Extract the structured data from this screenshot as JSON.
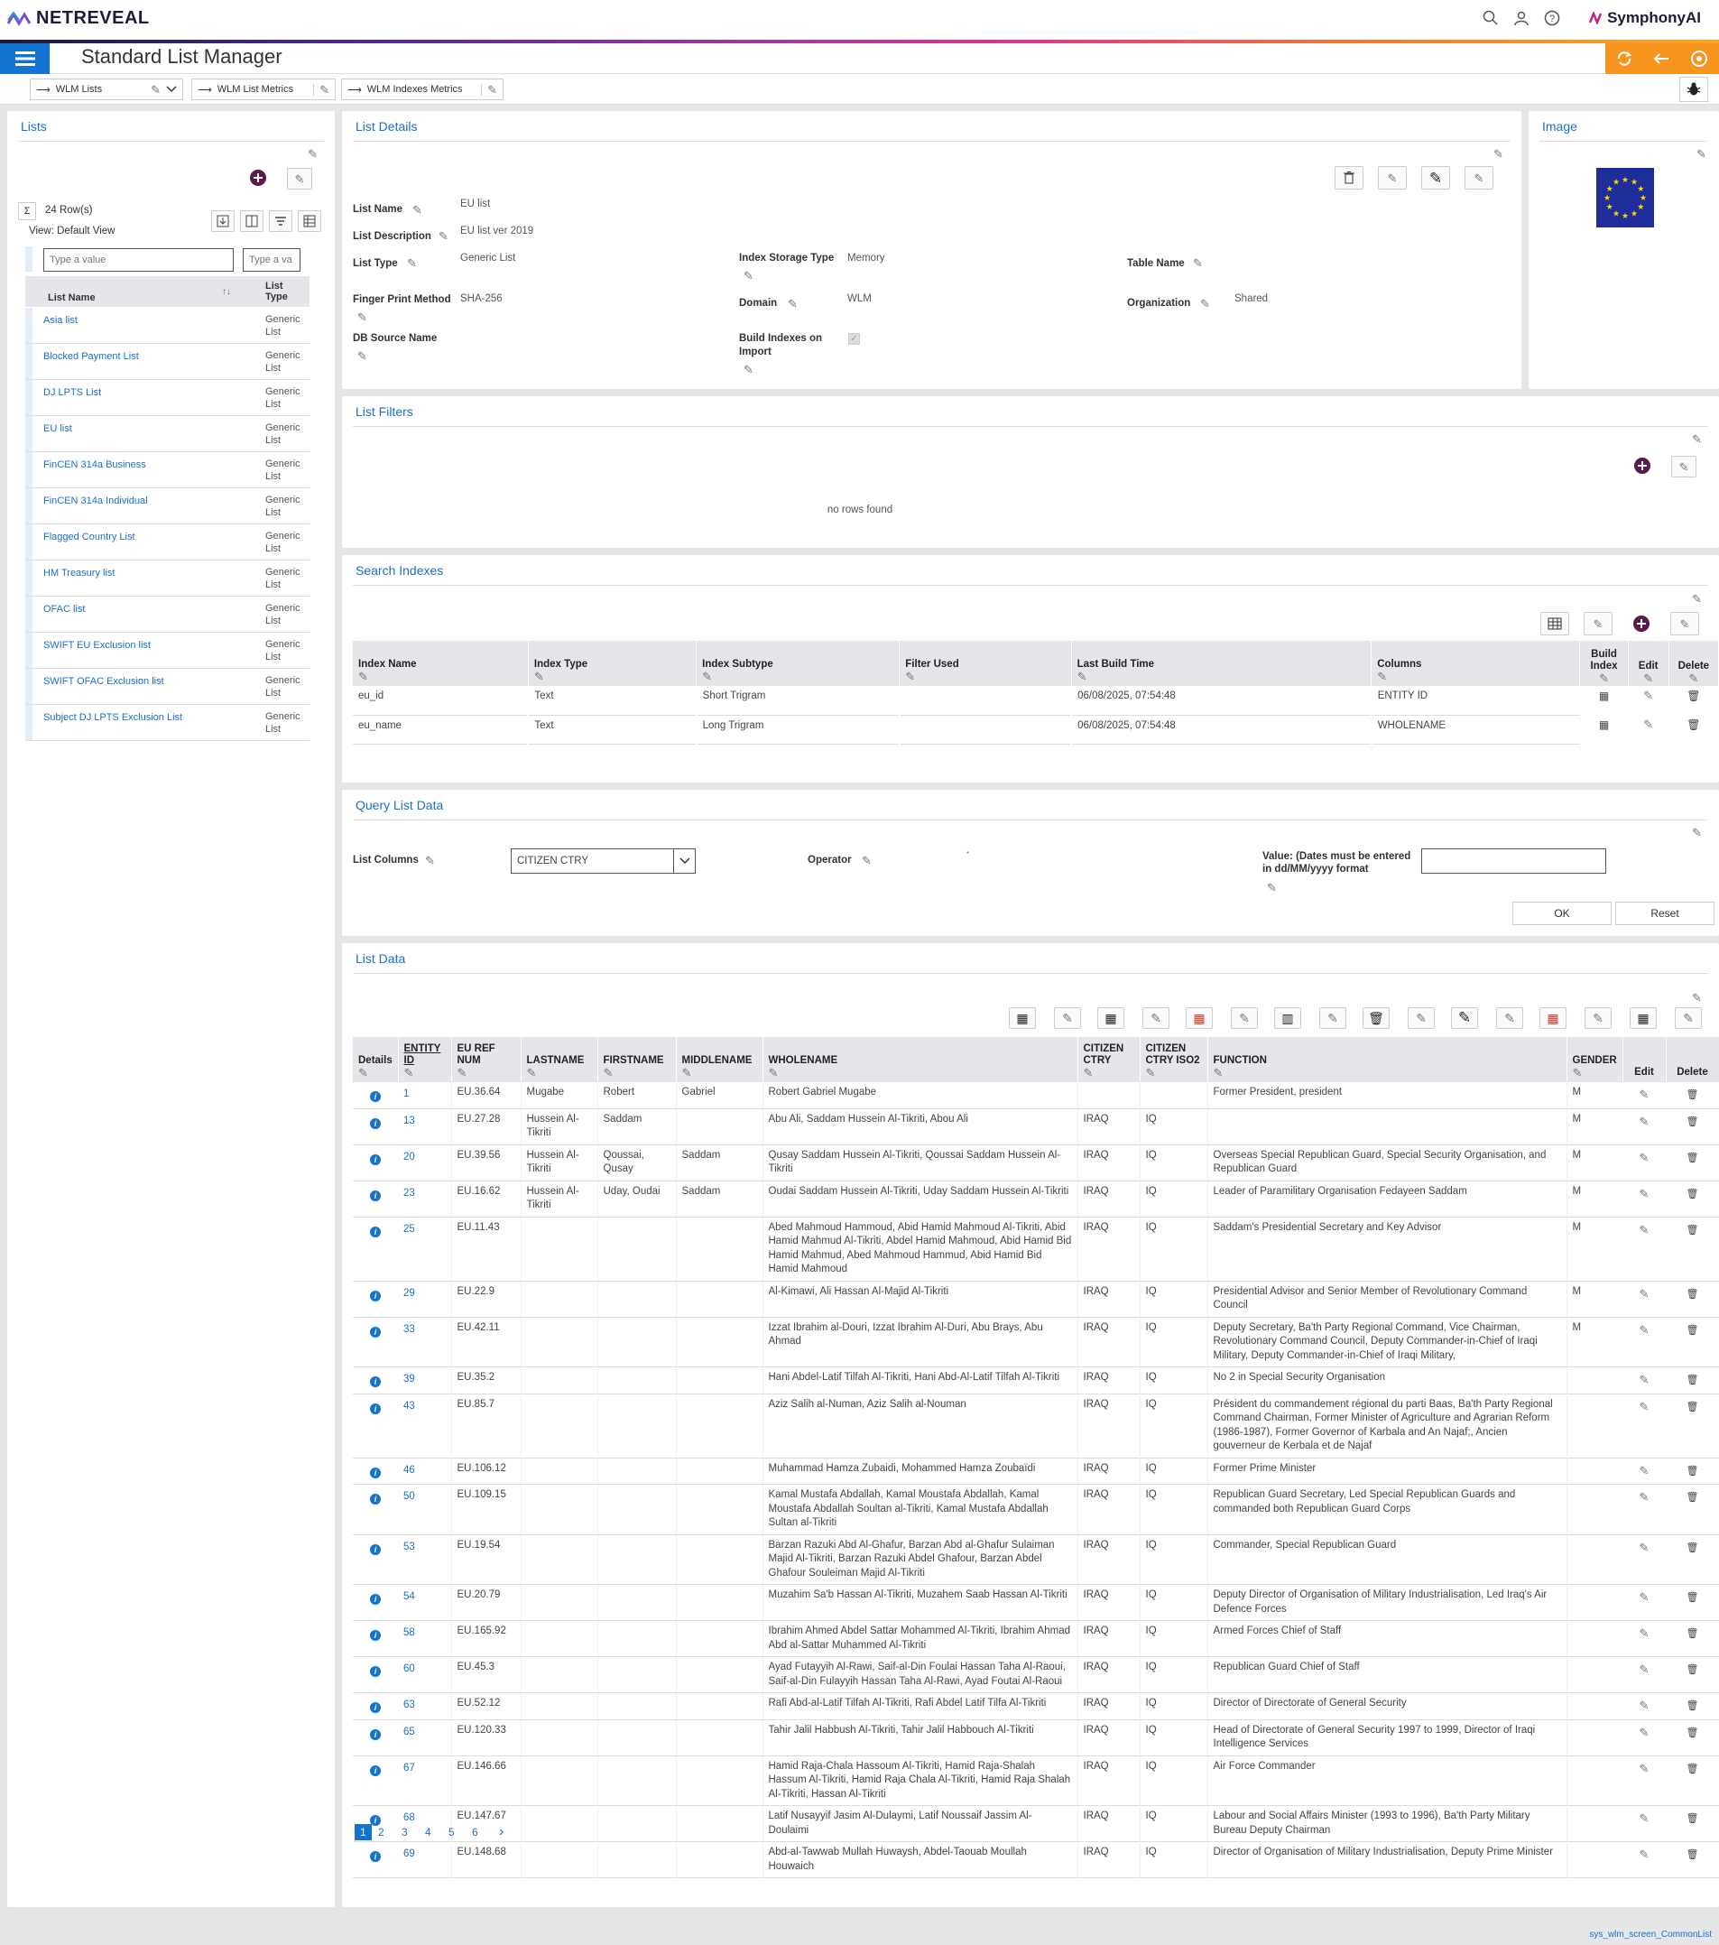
{
  "header": {
    "logo": "NETREVEAL",
    "brand": "SymphonyAI",
    "app_title": "Standard List Manager"
  },
  "tabs": [
    {
      "label": "WLM Lists"
    },
    {
      "label": "WLM List Metrics"
    },
    {
      "label": "WLM Indexes Metrics"
    }
  ],
  "lists_panel": {
    "title": "Lists",
    "row_count": "24 Row(s)",
    "view": "View: Default View",
    "filter_placeholder": "Type a value",
    "filter_placeholder2": "Type a va",
    "col_name": "List Name",
    "col_type": "List Type",
    "items": [
      {
        "name": "Asia list",
        "type": "Generic List"
      },
      {
        "name": "Blocked Payment List",
        "type": "Generic List"
      },
      {
        "name": "DJ LPTS List",
        "type": "Generic List"
      },
      {
        "name": "EU list",
        "type": "Generic List"
      },
      {
        "name": "FinCEN 314a Business",
        "type": "Generic List"
      },
      {
        "name": "FinCEN 314a Individual",
        "type": "Generic List"
      },
      {
        "name": "Flagged Country List",
        "type": "Generic List"
      },
      {
        "name": "HM Treasury list",
        "type": "Generic List"
      },
      {
        "name": "OFAC list",
        "type": "Generic List"
      },
      {
        "name": "SWIFT EU Exclusion list",
        "type": "Generic List"
      },
      {
        "name": "SWIFT OFAC Exclusion list",
        "type": "Generic List"
      },
      {
        "name": "Subject DJ LPTS Exclusion List",
        "type": "Generic List"
      }
    ]
  },
  "details": {
    "title": "List Details",
    "list_name_lbl": "List Name",
    "list_name": "EU list",
    "list_desc_lbl": "List Description",
    "list_desc": "EU list ver 2019",
    "list_type_lbl": "List Type",
    "list_type": "Generic List",
    "fp_lbl": "Finger Print Method",
    "fp": "SHA-256",
    "db_lbl": "DB Source Name",
    "storage_lbl": "Index Storage Type",
    "storage": "Memory",
    "domain_lbl": "Domain",
    "domain": "WLM",
    "build_lbl": "Build Indexes on Import",
    "table_lbl": "Table Name",
    "org_lbl": "Organization",
    "org": "Shared"
  },
  "image_panel": {
    "title": "Image"
  },
  "filters": {
    "title": "List Filters",
    "empty": "no rows found"
  },
  "indexes": {
    "title": "Search Indexes",
    "headers": [
      "Index Name",
      "Index Type",
      "Index Subtype",
      "Filter Used",
      "Last Build Time",
      "Columns",
      "Build Index",
      "Edit",
      "Delete"
    ],
    "rows": [
      {
        "name": "eu_id",
        "type": "Text",
        "subtype": "Short Trigram",
        "filter": "",
        "time": "06/08/2025, 07:54:48",
        "columns": "ENTITY ID"
      },
      {
        "name": "eu_name",
        "type": "Text",
        "subtype": "Long Trigram",
        "filter": "",
        "time": "06/08/2025, 07:54:48",
        "columns": "WHOLENAME"
      }
    ]
  },
  "query": {
    "title": "Query List Data",
    "cols_lbl": "List Columns",
    "cols_val": "CITIZEN CTRY",
    "op_lbl": "Operator",
    "value_lbl": "Value: (Dates must be entered in dd/MM/yyyy format",
    "ok": "OK",
    "reset": "Reset"
  },
  "listdata": {
    "title": "List Data",
    "headers": [
      "Details",
      "ENTITY ID",
      "EU REF NUM",
      "LASTNAME",
      "FIRSTNAME",
      "MIDDLENAME",
      "WHOLENAME",
      "CITIZEN CTRY",
      "CITIZEN CTRY ISO2",
      "FUNCTION",
      "GENDER",
      "Edit",
      "Delete"
    ],
    "rows": [
      {
        "id": "1",
        "ref": "EU.36.64",
        "last": "Mugabe",
        "first": "Robert",
        "middle": "Gabriel",
        "whole": "Robert Gabriel Mugabe",
        "ctry": "",
        "iso": "",
        "func": "Former President, president",
        "gender": "M"
      },
      {
        "id": "13",
        "ref": "EU.27.28",
        "last": "Hussein Al-Tikriti",
        "first": "Saddam",
        "middle": "",
        "whole": "Abu Ali, Saddam Hussein Al-Tikriti, Abou Ali",
        "ctry": "IRAQ",
        "iso": "IQ",
        "func": "",
        "gender": "M"
      },
      {
        "id": "20",
        "ref": "EU.39.56",
        "last": "Hussein Al-Tikriti",
        "first": "Qoussai, Qusay",
        "middle": "Saddam",
        "whole": "Qusay Saddam Hussein Al-Tikriti, Qoussai Saddam Hussein Al-Tikriti",
        "ctry": "IRAQ",
        "iso": "IQ",
        "func": "Overseas Special Republican Guard, Special Security Organisation, and Republican Guard",
        "gender": "M"
      },
      {
        "id": "23",
        "ref": "EU.16.62",
        "last": "Hussein Al-Tikriti",
        "first": "Uday, Oudai",
        "middle": "Saddam",
        "whole": "Oudai Saddam Hussein Al-Tikriti, Uday Saddam Hussein Al-Tikriti",
        "ctry": "IRAQ",
        "iso": "IQ",
        "func": "Leader of Paramilitary Organisation Fedayeen Saddam",
        "gender": "M"
      },
      {
        "id": "25",
        "ref": "EU.11.43",
        "last": "",
        "first": "",
        "middle": "",
        "whole": "Abed Mahmoud Hammoud, Abid Hamid Mahmoud Al-Tikriti, Abid Hamid Mahmud Al-Tikriti, Abdel Hamid Mahmoud, Abid Hamid Bid Hamid Mahmud, Abed Mahmoud Hammud, Abid Hamid Bid Hamid Mahmoud",
        "ctry": "IRAQ",
        "iso": "IQ",
        "func": "Saddam's Presidential Secretary and Key Advisor",
        "gender": "M"
      },
      {
        "id": "29",
        "ref": "EU.22.9",
        "last": "",
        "first": "",
        "middle": "",
        "whole": "Al-Kimawi, Ali Hassan Al-Majid Al-Tikriti",
        "ctry": "IRAQ",
        "iso": "IQ",
        "func": "Presidential Advisor and Senior Member of Revolutionary Command Council",
        "gender": "M"
      },
      {
        "id": "33",
        "ref": "EU.42.11",
        "last": "",
        "first": "",
        "middle": "",
        "whole": "Izzat Ibrahim al-Douri, Izzat Ibrahim Al-Duri, Abu Brays, Abu Ahmad",
        "ctry": "IRAQ",
        "iso": "IQ",
        "func": "Deputy Secretary, Ba'th Party Regional Command, Vice Chairman, Revolutionary Command Council, Deputy Commander-in-Chief of Iraqi Military, Deputy Commander-in-Chief of Iraqi Military,",
        "gender": "M"
      },
      {
        "id": "39",
        "ref": "EU.35.2",
        "last": "",
        "first": "",
        "middle": "",
        "whole": "Hani Abdel-Latif Tilfah Al-Tikriti, Hani Abd-Al-Latif Tilfah Al-Tikriti",
        "ctry": "IRAQ",
        "iso": "IQ",
        "func": "No 2 in Special Security Organisation",
        "gender": ""
      },
      {
        "id": "43",
        "ref": "EU.85.7",
        "last": "",
        "first": "",
        "middle": "",
        "whole": "Aziz Salih al-Numan, Aziz Salih al-Nouman",
        "ctry": "IRAQ",
        "iso": "IQ",
        "func": "Président du commandement régional du parti Baas, Ba'th Party Regional Command Chairman, Former Minister of Agriculture and Agrarian Reform (1986-1987), Former Governor of Karbala and An Najaf;, Ancien gouverneur de Kerbala et de Najaf",
        "gender": ""
      },
      {
        "id": "46",
        "ref": "EU.106.12",
        "last": "",
        "first": "",
        "middle": "",
        "whole": "Muhammad Hamza Zubaidi, Mohammed Hamza Zoubaïdi",
        "ctry": "IRAQ",
        "iso": "IQ",
        "func": "Former Prime Minister",
        "gender": ""
      },
      {
        "id": "50",
        "ref": "EU.109.15",
        "last": "",
        "first": "",
        "middle": "",
        "whole": "Kamal Mustafa Abdallah, Kamal Moustafa Abdallah, Kamal Moustafa Abdallah Soultan al-Tikriti, Kamal Mustafa Abdallah Sultan al-Tikriti",
        "ctry": "IRAQ",
        "iso": "IQ",
        "func": "Republican Guard Secretary, Led Special Republican Guards and commanded both Republican Guard Corps",
        "gender": ""
      },
      {
        "id": "53",
        "ref": "EU.19.54",
        "last": "",
        "first": "",
        "middle": "",
        "whole": "Barzan Razuki Abd Al-Ghafur, Barzan Abd al-Ghafur Sulaiman Majid Al-Tikriti, Barzan Razuki Abdel Ghafour, Barzan Abdel Ghafour Souleiman Majid Al-Tikriti",
        "ctry": "IRAQ",
        "iso": "IQ",
        "func": "Commander, Special Republican Guard",
        "gender": ""
      },
      {
        "id": "54",
        "ref": "EU.20.79",
        "last": "",
        "first": "",
        "middle": "",
        "whole": "Muzahim Sa'b Hassan Al-Tikriti, Muzahem Saab Hassan Al-Tikriti",
        "ctry": "IRAQ",
        "iso": "IQ",
        "func": "Deputy Director of Organisation of Military Industrialisation, Led Iraq's Air Defence Forces",
        "gender": ""
      },
      {
        "id": "58",
        "ref": "EU.165.92",
        "last": "",
        "first": "",
        "middle": "",
        "whole": "Ibrahim Ahmed Abdel Sattar Mohammed Al-Tikriti, Ibrahim Ahmad Abd al-Sattar Muhammed Al-Tikriti",
        "ctry": "IRAQ",
        "iso": "IQ",
        "func": "Armed Forces Chief of Staff",
        "gender": ""
      },
      {
        "id": "60",
        "ref": "EU.45.3",
        "last": "",
        "first": "",
        "middle": "",
        "whole": "Ayad Futayyih Al-Rawi, Saif-al-Din Foulai Hassan Taha Al-Raoui, Saif-al-Din Fulayyih Hassan Taha Al-Rawi, Ayad Foutai Al-Raoui",
        "ctry": "IRAQ",
        "iso": "IQ",
        "func": "Republican Guard Chief of Staff",
        "gender": ""
      },
      {
        "id": "63",
        "ref": "EU.52.12",
        "last": "",
        "first": "",
        "middle": "",
        "whole": "Rafi Abd-al-Latif Tilfah Al-Tikriti, Rafi Abdel Latif Tilfa Al-Tikriti",
        "ctry": "IRAQ",
        "iso": "IQ",
        "func": "Director of Directorate of General Security",
        "gender": ""
      },
      {
        "id": "65",
        "ref": "EU.120.33",
        "last": "",
        "first": "",
        "middle": "",
        "whole": "Tahir Jalil Habbush Al-Tikriti, Tahir Jalil Habbouch Al-Tikriti",
        "ctry": "IRAQ",
        "iso": "IQ",
        "func": "Head of Directorate of General Security 1997 to 1999, Director of Iraqi Intelligence Services",
        "gender": ""
      },
      {
        "id": "67",
        "ref": "EU.146.66",
        "last": "",
        "first": "",
        "middle": "",
        "whole": "Hamid Raja-Chala Hassoum Al-Tikriti, Hamid Raja-Shalah Hassum Al-Tikriti, Hamid Raja Chala Al-Tikriti, Hamid Raja Shalah Al-Tikriti, Hassan Al-Tikriti",
        "ctry": "IRAQ",
        "iso": "IQ",
        "func": "Air Force Commander",
        "gender": ""
      },
      {
        "id": "68",
        "ref": "EU.147.67",
        "last": "",
        "first": "",
        "middle": "",
        "whole": "Latif Nusayyif Jasim Al-Dulaymi, Latif Noussaif Jassim Al-Doulaimi",
        "ctry": "IRAQ",
        "iso": "IQ",
        "func": "Labour and Social Affairs Minister (1993 to 1996), Ba'th Party Military Bureau Deputy Chairman",
        "gender": ""
      },
      {
        "id": "69",
        "ref": "EU.148.68",
        "last": "",
        "first": "",
        "middle": "",
        "whole": "Abd-al-Tawwab Mullah Huwaysh, Abdel-Taouab Moullah Houwaich",
        "ctry": "IRAQ",
        "iso": "IQ",
        "func": "Director of Organisation of Military Industrialisation, Deputy Prime Minister",
        "gender": ""
      }
    ],
    "pages": [
      "1",
      "2",
      "3",
      "4",
      "5",
      "6"
    ],
    "next": "›"
  },
  "footer": "sys_wlm_screen_CommonList"
}
